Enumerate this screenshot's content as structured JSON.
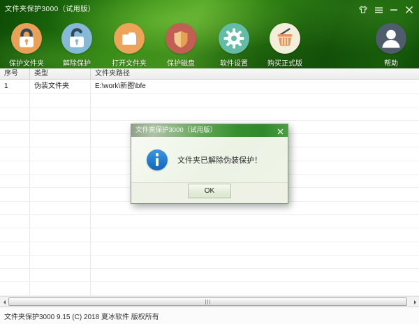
{
  "window": {
    "title": "文件夹保护3000（试用版）"
  },
  "titlebar_icons": [
    "skin-shirt-icon",
    "menu-icon",
    "minimize-icon",
    "close-icon"
  ],
  "toolbar": {
    "items": [
      {
        "label": "保护文件夹",
        "icon": "lock-closed-icon",
        "circle_color": "#e8a156"
      },
      {
        "label": "解除保护",
        "icon": "lock-open-icon",
        "circle_color": "#85b9d5"
      },
      {
        "label": "打开文件夹",
        "icon": "folder-icon",
        "circle_color": "#eca35a"
      },
      {
        "label": "保护磁盘",
        "icon": "shield-icon",
        "circle_color": "#c25f55"
      },
      {
        "label": "软件设置",
        "icon": "gear-icon",
        "circle_color": "#63bda6"
      },
      {
        "label": "购买正式版",
        "icon": "basket-icon",
        "circle_color": "#f3eeda"
      },
      {
        "label": "帮助",
        "icon": "user-icon",
        "circle_color": "#4e5c6b"
      }
    ]
  },
  "table": {
    "columns": [
      "序号",
      "类型",
      "文件夹路径"
    ],
    "rows": [
      {
        "num": "1",
        "type": "伪装文件夹",
        "path": "E:\\work\\新图\\bfe"
      }
    ],
    "empty_row_count": 15
  },
  "dialog": {
    "title": "文件夹保护3000（试用版）",
    "message": "文件夹已解除伪装保护！",
    "ok_label": "OK"
  },
  "statusbar": {
    "text": "文件夹保护3000 9.15 (C) 2018 夏冰软件 版权所有"
  },
  "colors": {
    "header_green_dark": "#0f4d07",
    "header_green_bright": "#52a525",
    "dialog_title_green": "#35902f",
    "info_blue": "#1b74c9",
    "icon_orange": "#e8a156",
    "icon_blue": "#85b9d5",
    "icon_red": "#c25f55",
    "icon_teal": "#63bda6",
    "icon_cream": "#f3eeda",
    "icon_slate": "#4e5c6b"
  }
}
